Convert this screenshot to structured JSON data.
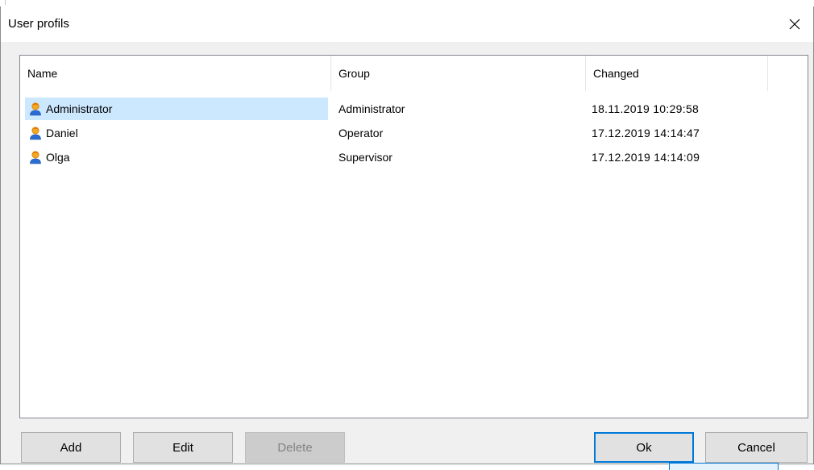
{
  "window": {
    "title": "User profils"
  },
  "list": {
    "columns": [
      "Name",
      "Group",
      "Changed"
    ],
    "rows": [
      {
        "name": "Administrator",
        "group": "Administrator",
        "changed": "18.11.2019 10:29:58",
        "icon": "user-icon",
        "selected": true
      },
      {
        "name": "Daniel",
        "group": "Operator",
        "changed": "17.12.2019 14:14:47",
        "icon": "user-icon",
        "selected": false
      },
      {
        "name": "Olga",
        "group": "Supervisor",
        "changed": "17.12.2019 14:14:09",
        "icon": "user-icon",
        "selected": false
      }
    ]
  },
  "buttons": {
    "add": "Add",
    "edit": "Edit",
    "delete": "Delete",
    "ok": "Ok",
    "cancel": "Cancel"
  },
  "colors": {
    "selection": "#cce8ff",
    "default_button_border": "#0078d7",
    "disabled_text": "#838383"
  }
}
